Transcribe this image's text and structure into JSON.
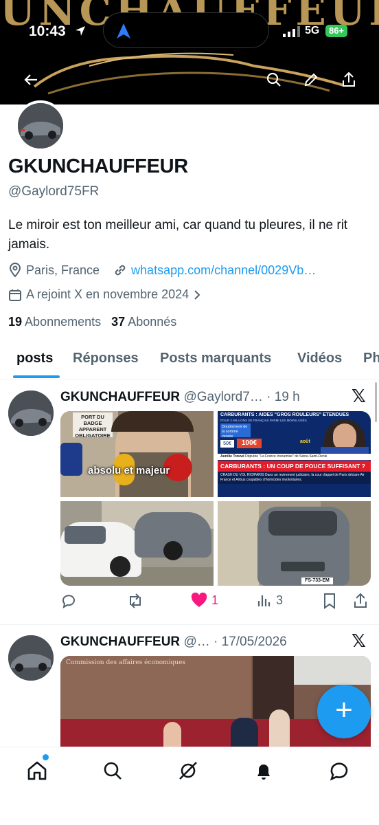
{
  "status": {
    "time": "10:43",
    "network": "5G",
    "battery": "86+"
  },
  "banner": {
    "text": "UNCHAUFFEUR"
  },
  "profile": {
    "name": "GKUNCHAUFFEUR",
    "handle": "@Gaylord75FR",
    "bio": "Le miroir est ton meilleur ami, car quand tu pleures, il ne rit jamais.",
    "location": "Paris, France",
    "website": "whatsapp.com/channel/0029Vb…",
    "joined": "A rejoint X en novembre 2024",
    "following_count": "19",
    "following_label": "Abonnements",
    "followers_count": "37",
    "followers_label": "Abonnés"
  },
  "tabs": [
    "posts",
    "Réponses",
    "Posts marquants",
    "Vidéos",
    "Ph"
  ],
  "posts": [
    {
      "author": "GKUNCHAUFFEUR",
      "handle": "@Gaylord7…",
      "time": "· 19 h",
      "media_captions": {
        "tile1_sign": "PORT DU BADGE APPARENT OBLIGATOIRE",
        "tile1_overlay": "absolu et majeur",
        "tile2_header": "CARBURANTS : AIDES \"GROS ROULEURS\" ÉTENDUES",
        "tile2_sub": "POUR 3 MILLIONS DE FRANÇAIS PARMI LES MOINS AISÉS",
        "tile2_box1": "Doublement de la somme versée",
        "tile2_price_from": "50€",
        "tile2_price_to": "100€",
        "tile2_month": "août",
        "tile2_name": "Aurélie Trouvé",
        "tile2_role": "Députée \"La France Insoumise\" de Seine-Saint-Denis",
        "tile2_banner": "CARBURANTS : UN COUP DE POUCE SUFFISANT ?",
        "tile2_ticker": "CRASH DU VOL RIO/PARIS Dans un revirement judiciaire, la cour d'appel de Paris déclare Air France et Airbus coupables d'homicides involontaires.",
        "tile4_plate": "FS-733-EM"
      },
      "replies": "",
      "reposts": "",
      "likes": "1",
      "views": "3"
    },
    {
      "author": "GKUNCHAUFFEUR",
      "handle": "@…",
      "time": "· 17/05/2026",
      "media_captions": {
        "wall_text": "Commission des affaires économiques"
      }
    }
  ],
  "colors": {
    "accent": "#1d9bf0",
    "like": "#f91880",
    "secondary": "#536471"
  }
}
